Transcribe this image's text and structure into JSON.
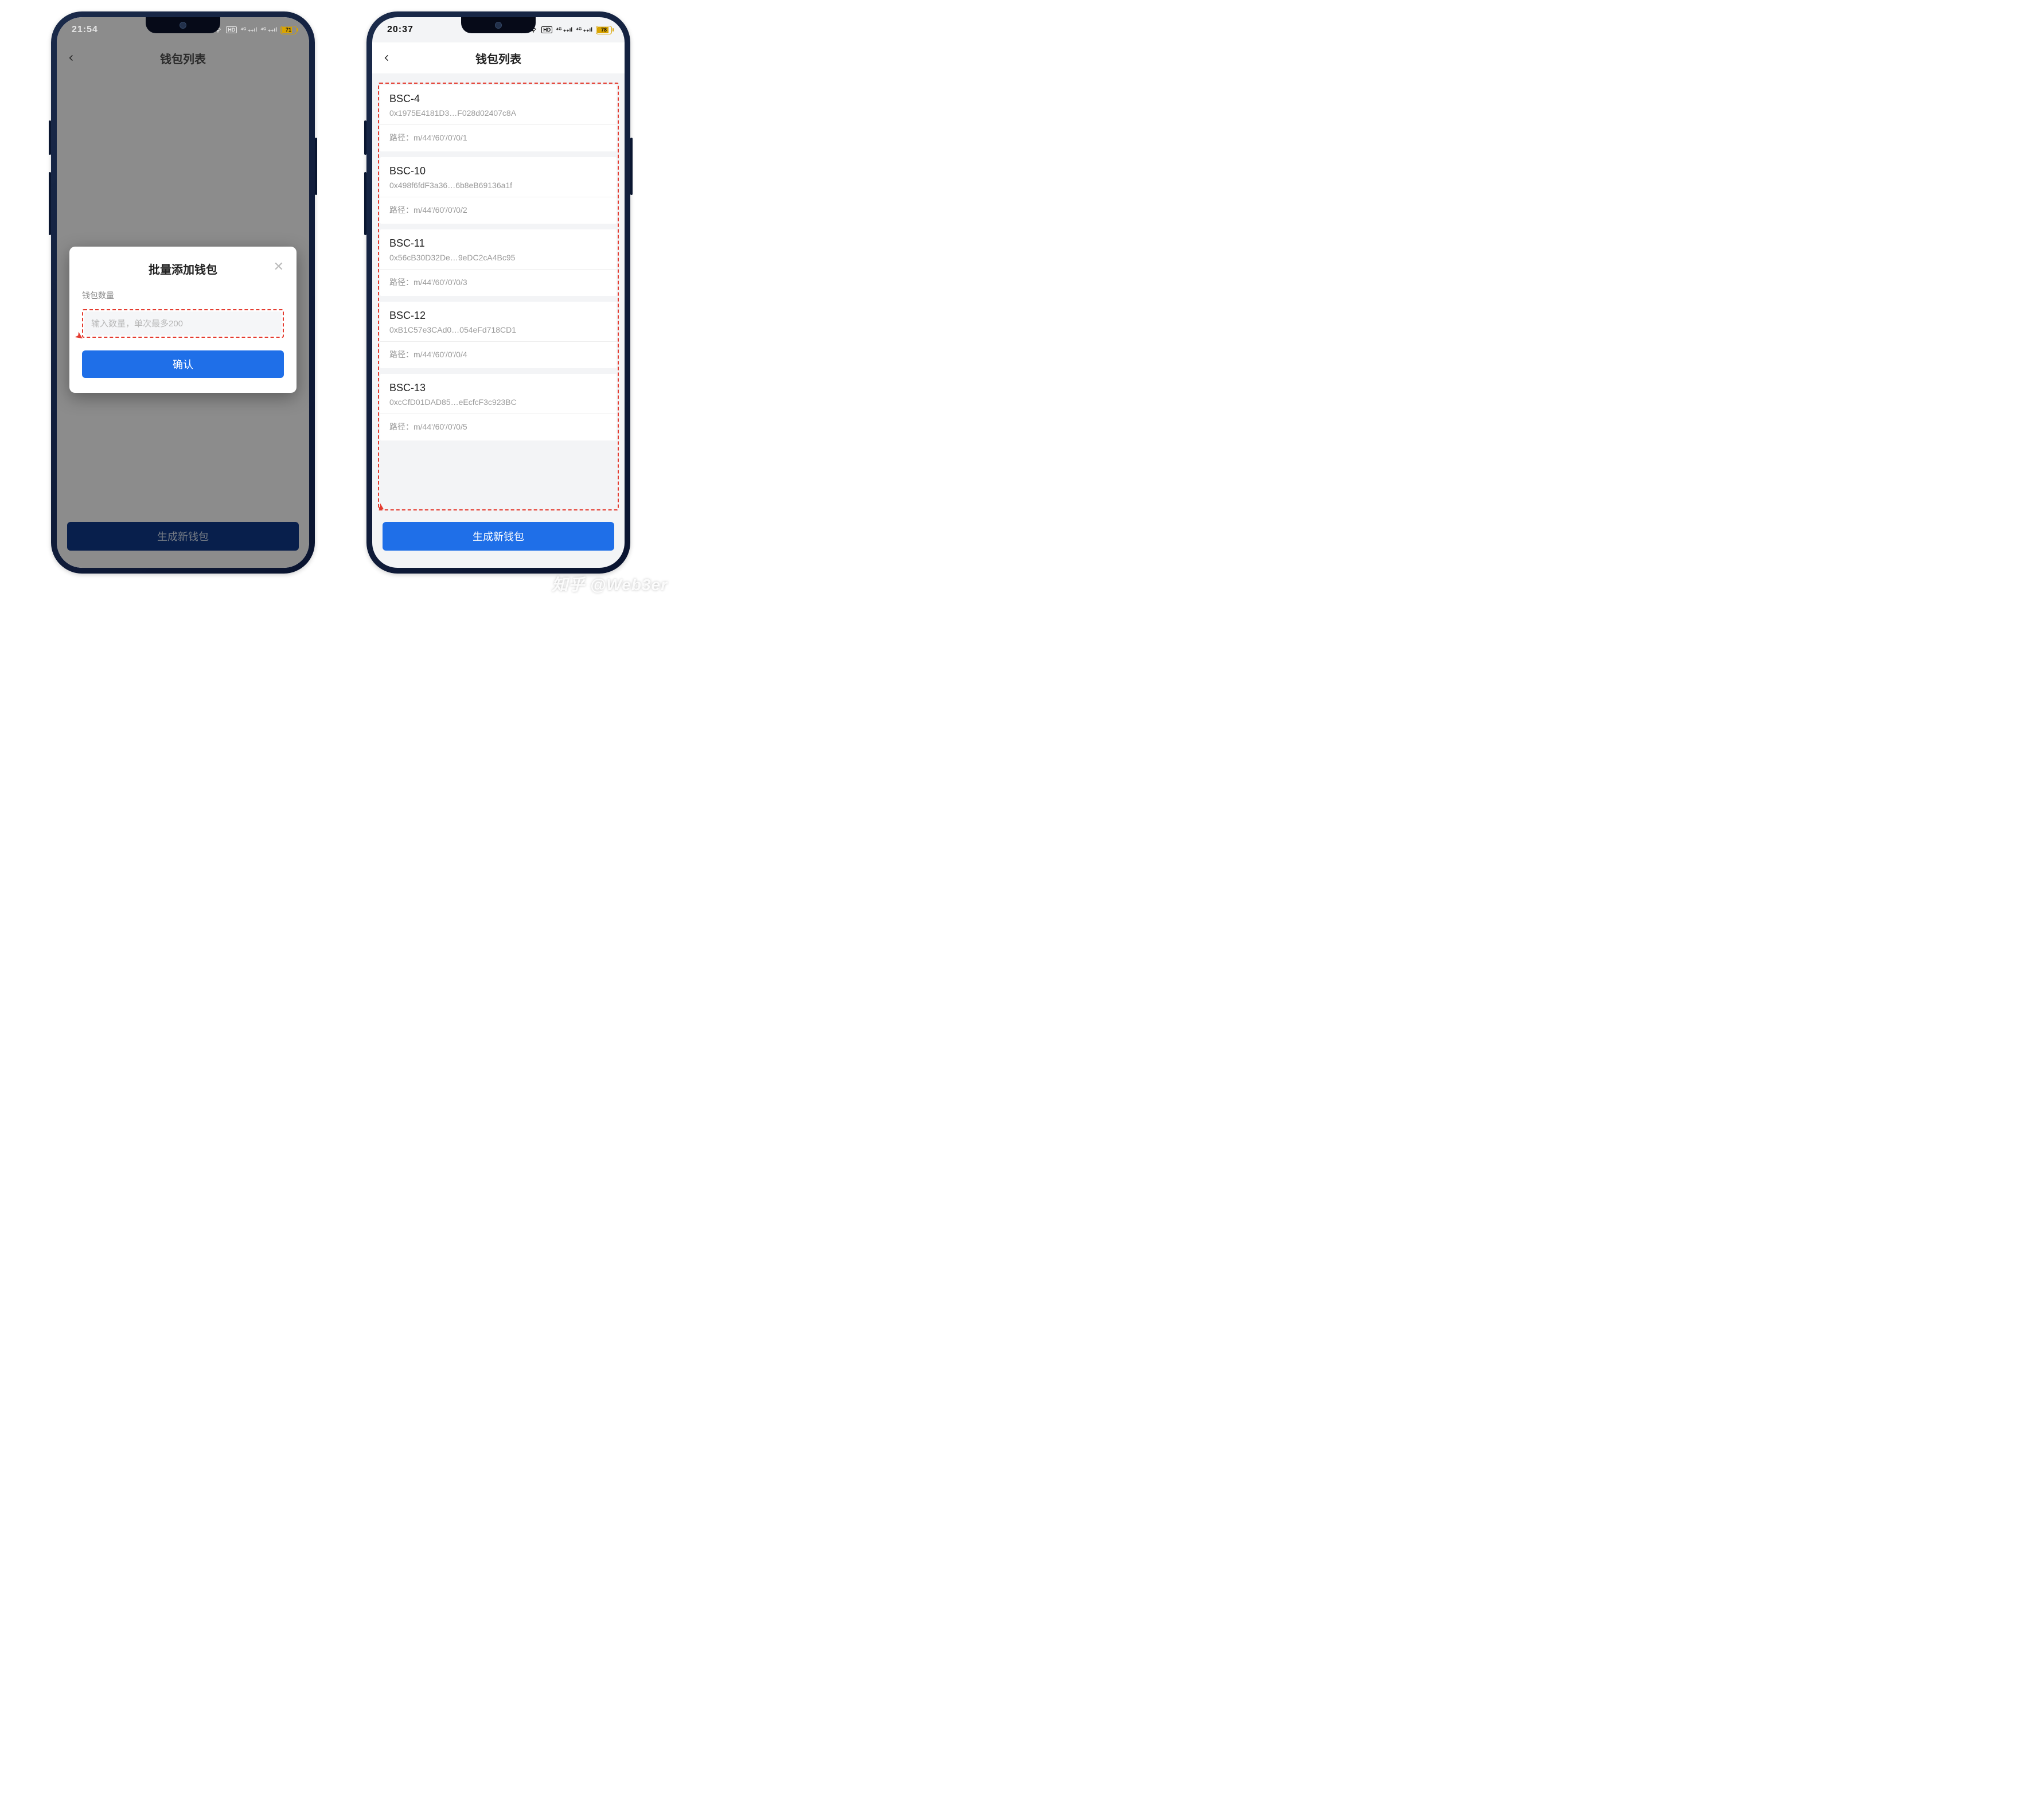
{
  "left": {
    "status": {
      "time": "21:54",
      "battery": "71",
      "hd_label": "HD"
    },
    "header": {
      "title": "钱包列表"
    },
    "modal": {
      "title": "批量添加钱包",
      "count_label": "钱包数量",
      "input_placeholder": "输入数量，单次最多200",
      "confirm": "确认"
    },
    "footer": {
      "generate": "生成新钱包"
    }
  },
  "right": {
    "status": {
      "time": "20:37",
      "battery": "78",
      "hd_label": "HD"
    },
    "header": {
      "title": "钱包列表"
    },
    "path_label": "路径：",
    "wallets": [
      {
        "name": "BSC-4",
        "address": "0x1975E4181D3…F028d02407c8A",
        "path": "m/44'/60'/0'/0/1"
      },
      {
        "name": "BSC-10",
        "address": "0x498f6fdF3a36…6b8eB69136a1f",
        "path": "m/44'/60'/0'/0/2"
      },
      {
        "name": "BSC-11",
        "address": "0x56cB30D32De…9eDC2cA4Bc95",
        "path": "m/44'/60'/0'/0/3"
      },
      {
        "name": "BSC-12",
        "address": "0xB1C57e3CAd0…054eFd718CD1",
        "path": "m/44'/60'/0'/0/4"
      },
      {
        "name": "BSC-13",
        "address": "0xcCfD01DAD85…eEcfcF3c923BC",
        "path": "m/44'/60'/0'/0/5"
      }
    ],
    "footer": {
      "generate": "生成新钱包"
    }
  },
  "watermark": "知乎 @Web3er"
}
